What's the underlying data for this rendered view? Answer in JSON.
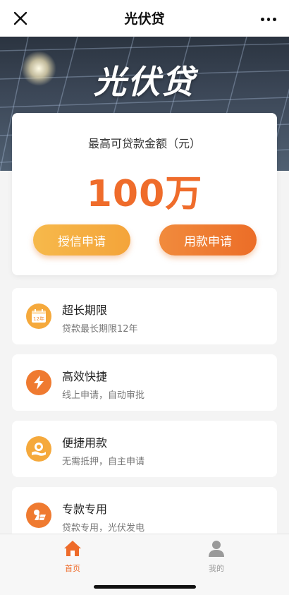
{
  "navbar": {
    "title": "光伏贷"
  },
  "banner": {
    "brand": "光伏贷"
  },
  "loan_card": {
    "label": "最高可贷款金额（元）",
    "amount": "100万",
    "credit_button": "授信申请",
    "loan_button": "用款申请"
  },
  "features": [
    {
      "title": "超长期限",
      "desc": "贷款最长期限12年",
      "icon": "calendar-icon",
      "icon_text": "12年"
    },
    {
      "title": "高效快捷",
      "desc": "线上申请，自动审批",
      "icon": "lightning-icon"
    },
    {
      "title": "便捷用款",
      "desc": "无需抵押，自主申请",
      "icon": "hand-coin-icon"
    },
    {
      "title": "专款专用",
      "desc": "贷款专用，光伏发电",
      "icon": "solar-panel-icon"
    }
  ],
  "tabbar": {
    "home_label": "首页",
    "mine_label": "我的"
  },
  "colors": {
    "accent": "#ef6c2b",
    "accent_light": "#f6b94b"
  }
}
